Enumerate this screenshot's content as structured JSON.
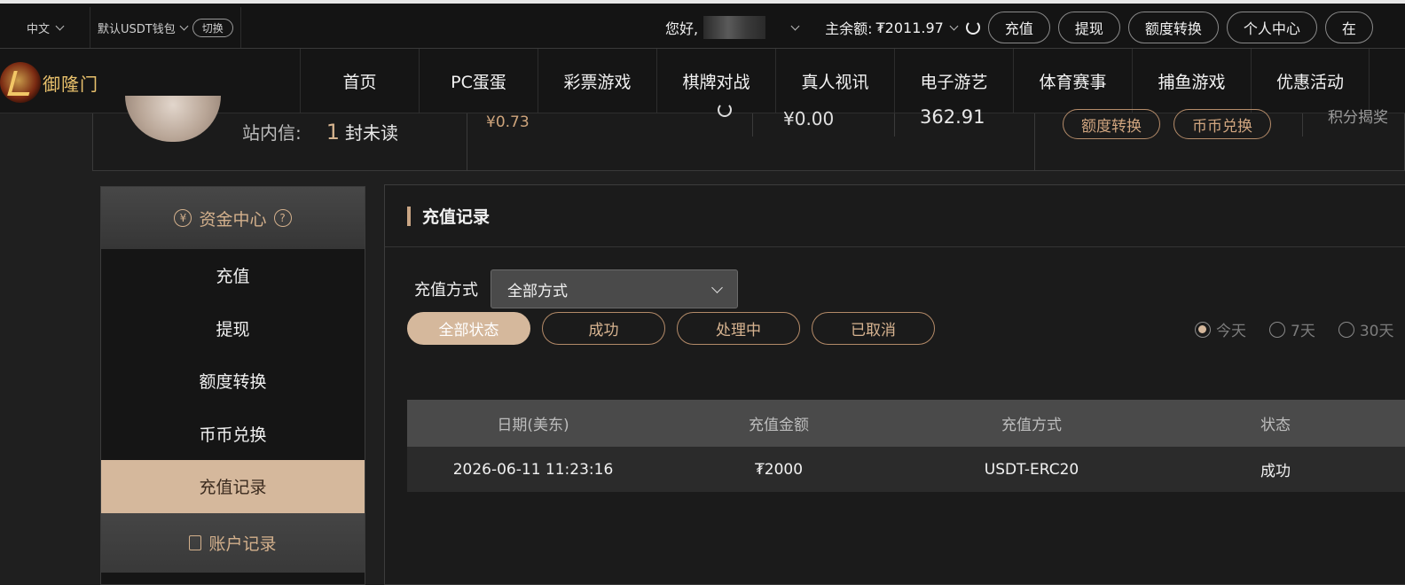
{
  "topbar": {
    "language": "中文",
    "wallet_label": "默认USDT钱包",
    "switch_label": "切换",
    "greeting": "您好,",
    "balance_label": "主余额:",
    "balance_value": "₮2011.97",
    "buttons": [
      "充值",
      "提现",
      "额度转换",
      "个人中心",
      "在"
    ]
  },
  "logo": {
    "text": "御隆门"
  },
  "nav": [
    "首页",
    "PC蛋蛋",
    "彩票游戏",
    "棋牌对战",
    "真人视讯",
    "电子游艺",
    "体育赛事",
    "捕鱼游戏",
    "优惠活动"
  ],
  "info_strip": {
    "message_label": "站内信:",
    "message_count": "1",
    "message_unread": "封未读",
    "amount_a": "¥0.73",
    "amount_b": "¥0.00",
    "amount_c": "362.91",
    "btn_transfer": "额度转换",
    "btn_exchange": "币币兑换",
    "cut_text": "积分揭奖"
  },
  "sidebar": {
    "header": "资金中心",
    "items": [
      "充值",
      "提现",
      "额度转换",
      "币币兑换",
      "充值记录"
    ],
    "active_index": 4,
    "sub_header": "账户记录"
  },
  "main": {
    "title": "充值记录",
    "method_label": "充值方式",
    "method_selected": "全部方式",
    "status_filters": [
      "全部状态",
      "成功",
      "处理中",
      "已取消"
    ],
    "ranges": [
      "今天",
      "7天",
      "30天"
    ],
    "table": {
      "headers": [
        "日期(美东)",
        "充值金额",
        "充值方式",
        "状态"
      ],
      "rows": [
        [
          "2026-06-11 11:23:16",
          "₮2000",
          "USDT-ERC20",
          "成功"
        ]
      ]
    }
  }
}
